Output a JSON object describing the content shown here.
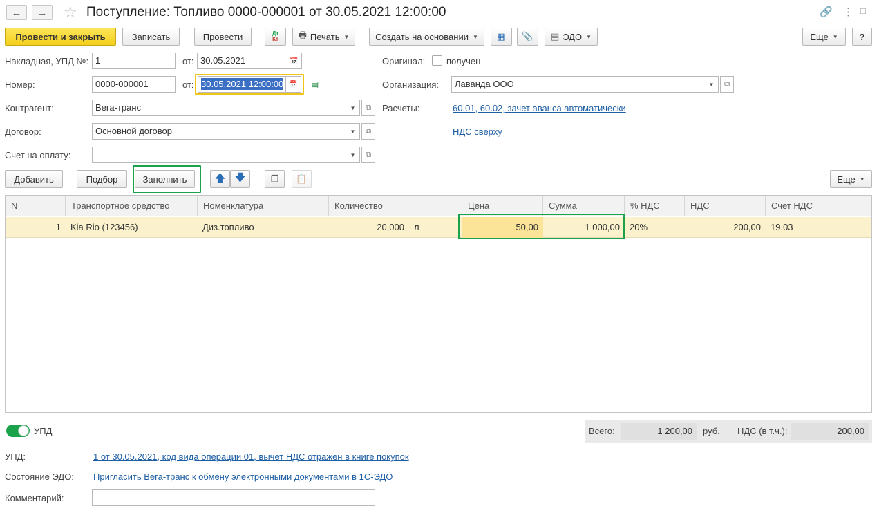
{
  "window": {
    "title": "Поступление: Топливо 0000-000001 от 30.05.2021 12:00:00"
  },
  "toolbar": {
    "post_and_close": "Провести и закрыть",
    "save": "Записать",
    "post": "Провести",
    "dtkt_top": "Дт",
    "dtkt_bottom": "Кт",
    "print": "Печать",
    "create_based": "Создать на основании",
    "edo": "ЭДО",
    "more": "Еще",
    "help": "?"
  },
  "form": {
    "invoice_label": "Накладная, УПД №:",
    "invoice_value": "1",
    "from_label": "от:",
    "invoice_date": "30.05.2021",
    "number_label": "Номер:",
    "number_value": "0000-000001",
    "from_label2": "от:",
    "doc_date": "30.05.2021 12:00:00",
    "counterparty_label": "Контрагент:",
    "counterparty_value": "Вега-транс",
    "contract_label": "Договор:",
    "contract_value": "Основной договор",
    "payment_invoice_label": "Счет на оплату:",
    "payment_invoice_value": "",
    "original_label": "Оригинал:",
    "original_checkbox_label": "получен",
    "organization_label": "Организация:",
    "organization_value": "Лаванда ООО",
    "settlements_label": "Расчеты:",
    "settlements_link": "60.01, 60.02, зачет аванса автоматически",
    "vat_link": "НДС сверху"
  },
  "table_toolbar": {
    "add": "Добавить",
    "pick": "Подбор",
    "fill": "Заполнить",
    "more": "Еще"
  },
  "table": {
    "columns": [
      "N",
      "Транспортное средство",
      "Номенклатура",
      "Количество",
      "Цена",
      "Сумма",
      "% НДС",
      "НДС",
      "Счет НДС"
    ],
    "rows": [
      {
        "n": "1",
        "vehicle": "Kia Rio (123456)",
        "item": "Диз.топливо",
        "qty": "20,000",
        "unit": "л",
        "price": "50,00",
        "sum": "1 000,00",
        "vat_rate": "20%",
        "vat": "200,00",
        "vat_account": "19.03"
      }
    ]
  },
  "footer": {
    "upd_toggle_label": "УПД",
    "total_label": "Всего:",
    "total_value": "1 200,00",
    "currency": "руб.",
    "vat_incl_label": "НДС (в т.ч.):",
    "vat_incl_value": "200,00",
    "upd_label": "УПД:",
    "upd_link": "1 от 30.05.2021, код вида операции 01, вычет НДС отражен в книге покупок",
    "edo_state_label": "Состояние ЭДО:",
    "edo_state_link": "Пригласить Вега-транс к обмену электронными документами в 1С-ЭДО",
    "comment_label": "Комментарий:",
    "comment_value": ""
  },
  "colors": {
    "primary_button": "#f4cf1c",
    "selected_row": "#fbf1cc",
    "highlight_frame": "#1aa34a",
    "link": "#1e5fa4",
    "focus_border": "#f0c419"
  }
}
